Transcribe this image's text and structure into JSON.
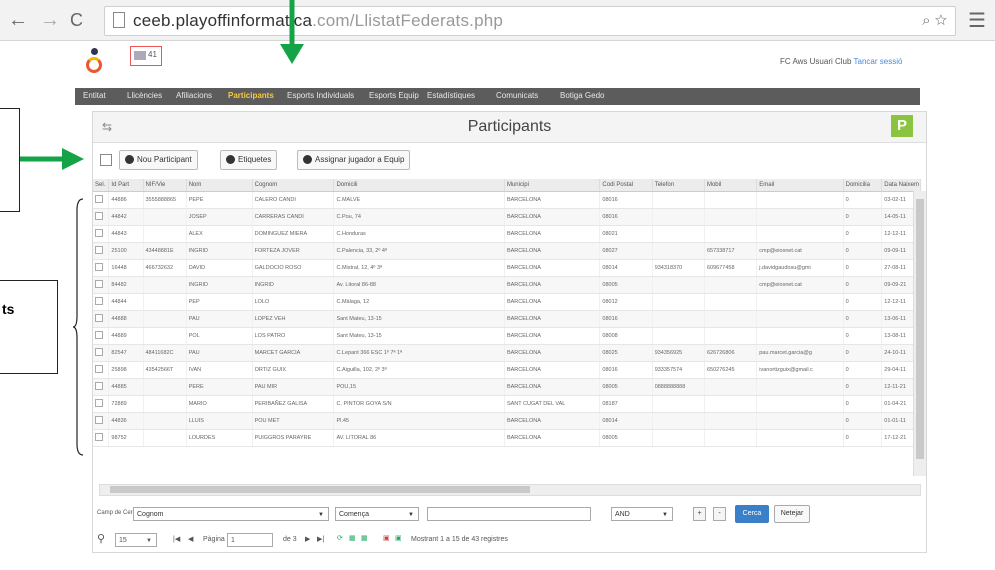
{
  "browser": {
    "url_host": "ceeb.playoffinformatica",
    "url_path": ".com/LlistatFederats.php"
  },
  "header": {
    "badge_text": "41",
    "user_prefix": "FC Aws Usuari Club",
    "user_link": "Tancar sessió"
  },
  "nav": {
    "items": [
      {
        "label": "Entitat",
        "left": 0
      },
      {
        "label": "Llicències",
        "left": 0
      },
      {
        "label": "Afiliacions",
        "left": 0
      },
      {
        "label": "Participants",
        "left": 0
      },
      {
        "label": "Esports Individuals",
        "left": 0
      },
      {
        "label": "Esports Equip",
        "left": 0
      },
      {
        "label": "Estadístiques",
        "left": 0
      },
      {
        "label": "Comunicats",
        "left": 0
      },
      {
        "label": "Botiga Gedo",
        "left": 0
      }
    ],
    "active_index": 3
  },
  "panel": {
    "title": "Participants",
    "badge": "P"
  },
  "toolbar": {
    "new_label": "Nou Participant",
    "labels_label": "Etiquetes",
    "assign_label": "Assignar jugador a Equip"
  },
  "grid": {
    "columns": [
      "Sel.",
      "Id Part",
      "NIF/Vie",
      "Nom",
      "Cognom",
      "Domicili",
      "Municipi",
      "Codi Postal",
      "Telefon",
      "Mobil",
      "Email",
      "Domicilia",
      "Data Naixem"
    ],
    "rows": [
      [
        "",
        "44886",
        "3555888865",
        "PEPE",
        "CALERO CANDI",
        "C.MALVE",
        "BARCELONA",
        "08016",
        "",
        "",
        "",
        "0",
        "03-02-11"
      ],
      [
        "",
        "44842",
        "",
        "JOSEP",
        "CARRERAS CANDI",
        "C.Pou, 74",
        "BARCELONA",
        "08016",
        "",
        "",
        "",
        "0",
        "14-05-11"
      ],
      [
        "",
        "44843",
        "",
        "ALEX",
        "DOMINGUEZ MIERA",
        "C.Honduras",
        "BARCELONA",
        "08021",
        "",
        "",
        "",
        "0",
        "12-12-11"
      ],
      [
        "",
        "25100",
        "43448881E",
        "INGRID",
        "FORTEZA JOVER",
        "C.Palencia, 33, 2º 4ª",
        "BARCELONA",
        "08027",
        "",
        "657338717",
        "cmp@eiosnet.cat",
        "0",
        "09-09-11"
      ],
      [
        "",
        "16448",
        "466732632",
        "DAVID",
        "GALDOCIO ROSO",
        "C.Mistral, 12, 4º 3ª",
        "BARCELONA",
        "08014",
        "934318370",
        "609677458",
        "j.davidgaudosu@gmi",
        "0",
        "27-08-11"
      ],
      [
        "",
        "84482",
        "",
        "INGRID",
        "INGRID",
        "Av. Litoral 86-88",
        "BARCELONA",
        "08005",
        "",
        "",
        "cmp@eiosnet.cat",
        "0",
        "09-09-21"
      ],
      [
        "",
        "44844",
        "",
        "PEP",
        "LOLO",
        "C.Màlaga, 12",
        "BARCELONA",
        "08012",
        "",
        "",
        "",
        "0",
        "12-12-11"
      ],
      [
        "",
        "44888",
        "",
        "PAU",
        "LOPEZ VEH",
        "Sant Mateu, 13-15",
        "BARCELONA",
        "08016",
        "",
        "",
        "",
        "0",
        "13-06-11"
      ],
      [
        "",
        "44889",
        "",
        "POL",
        "LOS PATRO",
        "Sant Mateu, 13-15",
        "BARCELONA",
        "08008",
        "",
        "",
        "",
        "0",
        "13-08-11"
      ],
      [
        "",
        "82547",
        "48411682C",
        "PAU",
        "MARCET GARCIA",
        "C.Lepant 366 ESC 1º 7ª 1ª",
        "BARCELONA",
        "08025",
        "934356925",
        "626726806",
        "pau.marcet.garcia@g",
        "0",
        "24-10-11"
      ],
      [
        "",
        "25898",
        "43542566T",
        "IVAN",
        "ORTIZ GUIX",
        "C.Aiguilla, 102, 2º 3ª",
        "BARCELONA",
        "08016",
        "933357574",
        "650276245",
        "ivanortizguix@gmail.c",
        "0",
        "29-04-11"
      ],
      [
        "",
        "44885",
        "",
        "PERE",
        "PAU MIR",
        "POU,15",
        "BARCELONA",
        "08005",
        "0888888888",
        "",
        "",
        "0",
        "12-11-21"
      ],
      [
        "",
        "72889",
        "",
        "MARIO",
        "PERIBAÑEZ GALISA",
        "C. PINTOR GOYA S/N",
        "SANT CUGAT DEL VAL",
        "08187",
        "",
        "",
        "",
        "0",
        "01-04-21"
      ],
      [
        "",
        "44836",
        "",
        "LLUIS",
        "POU MET",
        "Pl.45",
        "BARCELONA",
        "08014",
        "",
        "",
        "",
        "0",
        "01-01-11"
      ],
      [
        "",
        "98752",
        "",
        "LOURDES",
        "PUIGGROS PARAYRE",
        "AV. LITORAL 86",
        "BARCELONA",
        "08005",
        "",
        "",
        "",
        "0",
        "17-12-21"
      ]
    ]
  },
  "search": {
    "field_label": "Camp de Cerca",
    "field_value": "Cognom",
    "op_value": "Comença",
    "logic_value": "AND",
    "plus_label": "+",
    "minus_label": "-",
    "search_button": "Cerca",
    "reset_button": "Netejar"
  },
  "pager": {
    "page_size": "15",
    "page_label": "Pàgina",
    "page_value": "1",
    "of_label": "de 3",
    "summary": "Mostrant 1 a 15 de 43 registres"
  },
  "annotations": {
    "partial_label": "ts"
  },
  "colors": {
    "arrow_green": "#15a348",
    "nav_bg": "#5c5c5c",
    "nav_active": "#f7c948",
    "badge_green": "#8bc540",
    "search_blue": "#3a80c8"
  }
}
